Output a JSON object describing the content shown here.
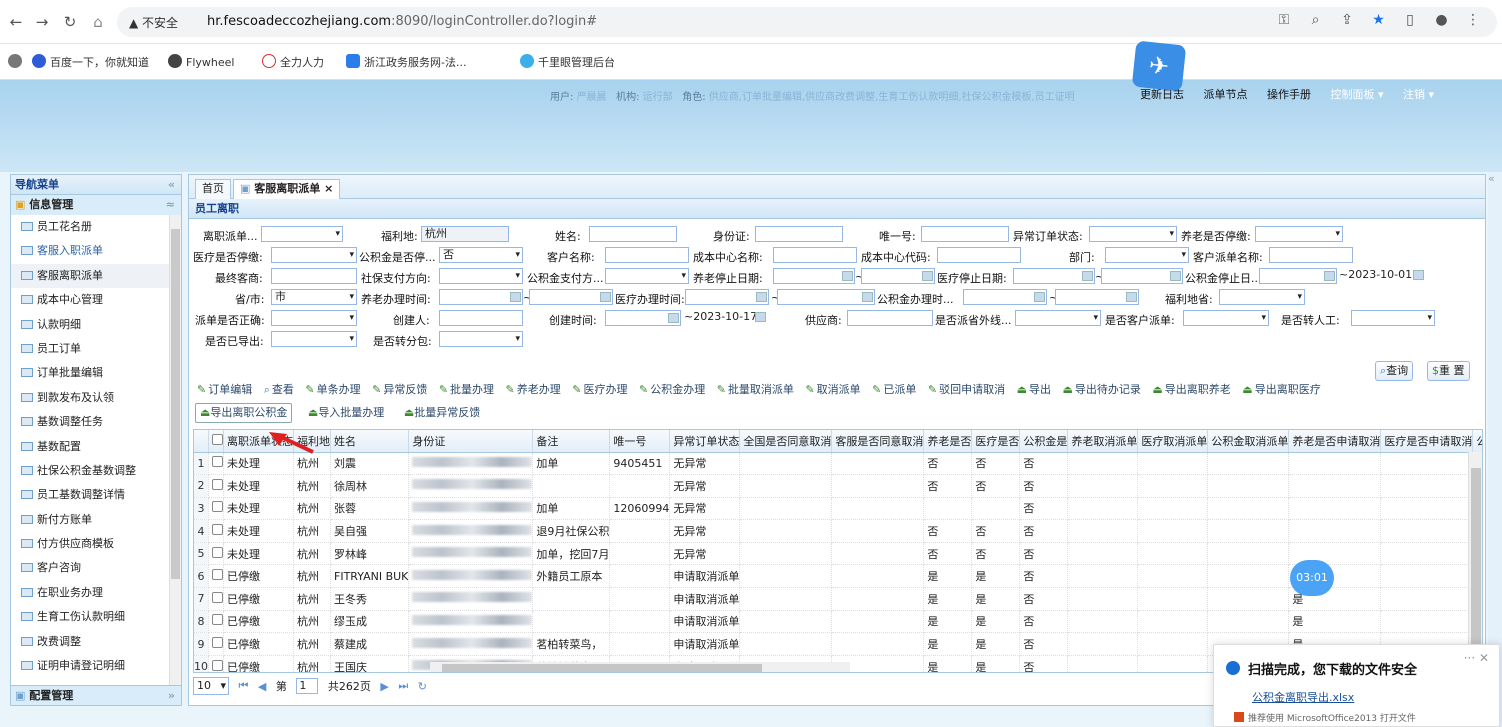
{
  "browser": {
    "security": "▲ 不安全",
    "url_host": "hr.fescoadeccozhejiang.com",
    "url_tail": ":8090/loginController.do?login#"
  },
  "bookmarks": [
    "百度一下，你就知道",
    "Flywheel",
    "全力人力",
    "浙江政务服务网-法...",
    "千里眼管理后台"
  ],
  "header": {
    "user_label": "用户:",
    "user_value": "严晨晨",
    "org_label": "机构:",
    "org_value": "运行部",
    "role_label": "角色:",
    "role_value": "供应商,订单批量编辑,供应商改费调整,生育工伤认款明细,社保公积金模板,员工证明",
    "links": [
      "更新日志",
      "派单节点",
      "操作手册"
    ],
    "control_panel": "控制面板 ▾",
    "logout": "注销 ▾"
  },
  "sidebar": {
    "title": "导航菜单",
    "section": "信息管理",
    "items": [
      "员工花名册",
      "客服入职派单",
      "客服离职派单",
      "成本中心管理",
      "认款明细",
      "员工订单",
      "订单批量编辑",
      "到款发布及认领",
      "基数调整任务",
      "基数配置",
      "社保公积金基数调整",
      "员工基数调整详情",
      "新付方账单",
      "付方供应商模板",
      "客户咨询",
      "在职业务办理",
      "生育工伤认款明细",
      "改费调整",
      "证明申请登记明细"
    ],
    "footer": "配置管理"
  },
  "tabs": {
    "home": "首页",
    "active": "客服离职派单 ×"
  },
  "panel_title": "员工离职",
  "filters": {
    "r1": [
      "离职派单...",
      "福利地:",
      "杭州",
      "姓名:",
      "身份证:",
      "唯一号:",
      "异常订单状态:",
      "养老是否停缴:"
    ],
    "r2": [
      "医疗是否停缴:",
      "公积金是否停...",
      "否",
      "客户名称:",
      "成本中心名称:",
      "成本中心代码:",
      "部门:",
      "客户派单名称:"
    ],
    "r3": [
      "最终客商:",
      "社保支付方向:",
      "公积金支付方...",
      "养老停止日期:",
      "~",
      "医疗停止日期:",
      "~",
      "公积金停止日...",
      "~2023-10-01"
    ],
    "r4": [
      "省/市:",
      "市",
      "养老办理时间:",
      "~",
      "医疗办理时间:",
      "~",
      "公积金办理时...",
      "~",
      "福利地省:"
    ],
    "r5": [
      "派单是否正确:",
      "创建人:",
      "创建时间:",
      "~2023-10-17",
      "供应商:",
      "是否派省外线...",
      "是否客户派单:",
      "是否转人工:"
    ],
    "r6": [
      "是否已导出:",
      "是否转分包:"
    ],
    "search": "查询",
    "reset": "重 置"
  },
  "toolbar": [
    "订单编辑",
    "查看",
    "单条办理",
    "异常反馈",
    "批量办理",
    "养老办理",
    "医疗办理",
    "公积金办理",
    "批量取消派单",
    "取消派单",
    "已派单",
    "驳回申请取消",
    "导出",
    "导出待办记录",
    "导出离职养老",
    "导出离职医疗"
  ],
  "toolbar2": [
    "导出离职公积金",
    "导入批量办理",
    "批量异常反馈"
  ],
  "table": {
    "headers": [
      "",
      "",
      "离职派单状态",
      "福利地",
      "姓名",
      "身份证",
      "备注",
      "唯一号",
      "异常订单状态",
      "全国是否同意取消",
      "客服是否同意取消",
      "养老是否",
      "医疗是否",
      "公积金是",
      "养老取消派单",
      "医疗取消派单",
      "公积金取消派单",
      "养老是否申请取消",
      "医疗是否申请取消",
      "公积"
    ],
    "rows": [
      [
        "1",
        "未处理",
        "杭州",
        "刘震",
        "加单",
        "9405451",
        "无异常",
        "",
        "",
        "否",
        "否",
        "否",
        "",
        "",
        "",
        "",
        "",
        "是"
      ],
      [
        "2",
        "未处理",
        "杭州",
        "徐周林",
        "",
        "",
        "无异常",
        "",
        "",
        "否",
        "否",
        "否",
        "",
        "",
        "",
        "",
        "",
        ""
      ],
      [
        "3",
        "未处理",
        "杭州",
        "张蓉",
        "加单",
        "12060994",
        "无异常",
        "",
        "",
        "",
        "",
        "否",
        "",
        "",
        "",
        "",
        "",
        ""
      ],
      [
        "4",
        "未处理",
        "杭州",
        "吴自强",
        "退9月社保公积",
        "",
        "无异常",
        "",
        "",
        "否",
        "否",
        "否",
        "",
        "",
        "",
        "",
        "",
        ""
      ],
      [
        "5",
        "未处理",
        "杭州",
        "罗林峰",
        "加单，挖回7月",
        "",
        "无异常",
        "",
        "",
        "否",
        "否",
        "否",
        "",
        "",
        "",
        "",
        "",
        ""
      ],
      [
        "6",
        "已停缴",
        "杭州",
        "FITRYANI BUK",
        "外籍员工原本",
        "",
        "申请取消派单",
        "",
        "",
        "是",
        "是",
        "否",
        "",
        "",
        "",
        "是",
        "",
        "是"
      ],
      [
        "7",
        "已停缴",
        "杭州",
        "王冬秀",
        "",
        "",
        "申请取消派单",
        "",
        "",
        "是",
        "是",
        "否",
        "",
        "",
        "",
        "是",
        "",
        "是"
      ],
      [
        "8",
        "已停缴",
        "杭州",
        "缪玉成",
        "",
        "",
        "申请取消派单",
        "",
        "",
        "是",
        "是",
        "否",
        "",
        "",
        "",
        "是",
        "",
        "是"
      ],
      [
        "9",
        "已停缴",
        "杭州",
        "蔡建成",
        "茗柏转菜鸟，",
        "",
        "申请取消派单",
        "",
        "",
        "是",
        "是",
        "否",
        "",
        "",
        "",
        "是",
        "",
        "是"
      ],
      [
        "10",
        "已停缴",
        "杭州",
        "王国庆",
        "茗柏转菜鸟，",
        "",
        "申请取消派单",
        "",
        "",
        "是",
        "是",
        "否",
        "",
        "",
        "",
        "是",
        "",
        "是"
      ]
    ]
  },
  "pager": {
    "size": "10",
    "page_prefix": "第",
    "page": "1",
    "total": "共262页"
  },
  "timer": "03:01",
  "download": {
    "title": "扫描完成，您下载的文件安全",
    "file": "公积金离职导出.xlsx",
    "tip": "推荐使用 MicrosoftOffice2013 打开文件"
  }
}
